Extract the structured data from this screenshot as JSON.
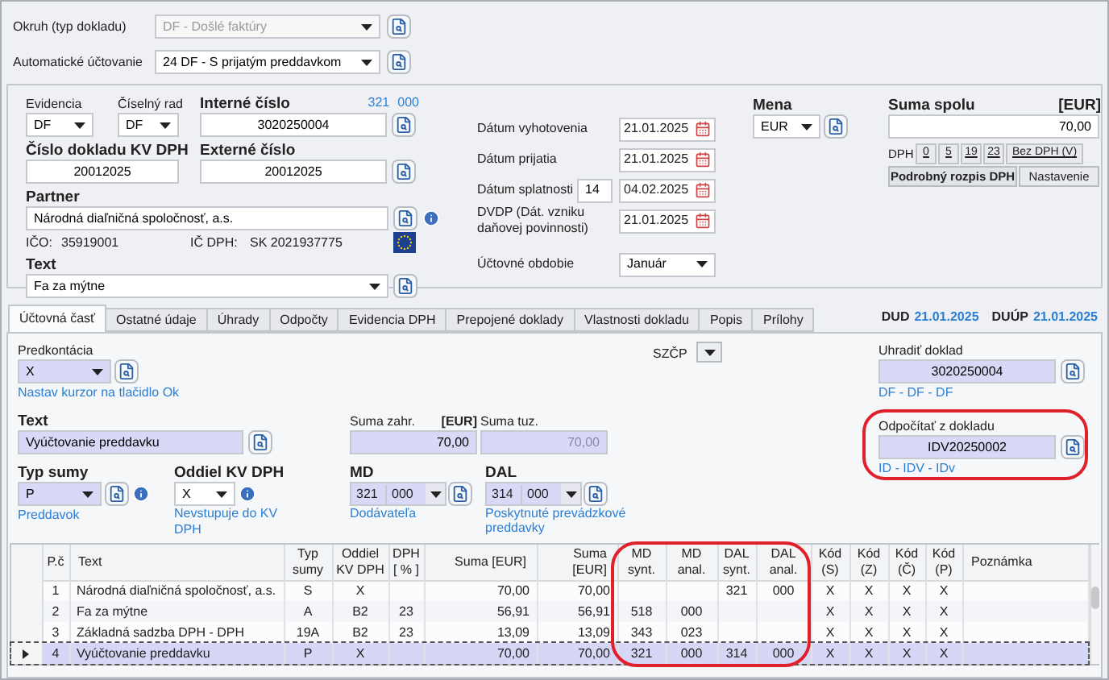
{
  "document_type": {
    "label": "Okruh (typ dokladu)",
    "value": "DF - Došlé faktúry",
    "disabled": true
  },
  "auto_posting": {
    "label": "Automatické účtovanie",
    "value": "24 DF - S prijatým preddavkom"
  },
  "evidence": {
    "label": "Evidencia",
    "value": "DF"
  },
  "number_series": {
    "label": "Číselný rad",
    "value": "DF"
  },
  "internal_number": {
    "label": "Interné číslo",
    "account_synt": "321",
    "account_anal": "000",
    "value": "3020250004"
  },
  "kv_dph_number": {
    "label": "Číslo dokladu KV DPH",
    "value": "20012025"
  },
  "external_number": {
    "label": "Externé číslo",
    "value": "20012025"
  },
  "partner": {
    "label": "Partner",
    "value": "Národná diaľničná spoločnosť, a.s.",
    "ico_label": "IČO:",
    "ico": "35919001",
    "ic_dph_label": "IČ DPH:",
    "ic_dph": "SK 2021937775"
  },
  "text": {
    "label": "Text",
    "value": "Fa za mýtne"
  },
  "dates": [
    {
      "label": "Dátum vyhotovenia",
      "value": "21.01.2025"
    },
    {
      "label": "Dátum prijatia",
      "value": "21.01.2025"
    },
    {
      "label": "Dátum splatnosti",
      "days": "14",
      "value": "04.02.2025"
    },
    {
      "label": "DVDP (Dát. vzniku daňovej povinnosti)",
      "value": "21.01.2025"
    }
  ],
  "accounting_period": {
    "label": "Účtovné obdobie",
    "value": "Január"
  },
  "currency": {
    "label": "Mena",
    "value": "EUR"
  },
  "total": {
    "label": "Suma spolu",
    "unit": "[EUR]",
    "value": "70,00",
    "vat_label": "DPH",
    "vat_buttons": [
      "0",
      "5",
      "19",
      "23",
      "Bez DPH (V)"
    ],
    "buttons": [
      "Podrobný rozpis DPH",
      "Nastavenie"
    ]
  },
  "tabs": [
    {
      "label": "Účtovná časť",
      "selected": true
    },
    {
      "label": "Ostatné údaje",
      "selected": false
    },
    {
      "label": "Úhrady",
      "selected": false
    },
    {
      "label": "Odpočty",
      "selected": false
    },
    {
      "label": "Evidencia DPH",
      "selected": false
    },
    {
      "label": "Prepojené doklady",
      "selected": false
    },
    {
      "label": "Vlastnosti dokladu",
      "selected": false
    },
    {
      "label": "Popis",
      "selected": false
    },
    {
      "label": "Prílohy",
      "selected": false
    }
  ],
  "due_dates": [
    {
      "label": "DUD",
      "value": "21.01.2025"
    },
    {
      "label": "DUÚP",
      "value": "21.01.2025"
    }
  ],
  "predkontacia": {
    "label": "Predkontácia",
    "value": "X",
    "hint": "Nastav kurzor na tlačidlo Ok"
  },
  "szcp": {
    "label": "SZČP"
  },
  "line_text": {
    "label": "Text",
    "value": "Vyúčtovanie preddavku"
  },
  "amount_foreign": {
    "label": "Suma zahr.",
    "unit": "[EUR]",
    "value": "70,00"
  },
  "amount_local": {
    "label": "Suma tuz.",
    "value": "70,00",
    "disabled": true
  },
  "amount_type": {
    "label": "Typ sumy",
    "value": "P",
    "hint": "Preddavok"
  },
  "kv_section": {
    "label": "Oddiel KV DPH",
    "value": "X",
    "hint": "Nevstupuje do KV DPH"
  },
  "md": {
    "label": "MD",
    "synt": "321",
    "anal": "000",
    "hint": "Dodávateľa"
  },
  "dal": {
    "label": "DAL",
    "synt": "314",
    "anal": "000",
    "hint": "Poskytnuté prevádzkové preddavky"
  },
  "pay_document": {
    "label": "Uhradiť doklad",
    "value": "3020250004",
    "link": "DF - DF - DF"
  },
  "deduct_document": {
    "label": "Odpočítať z dokladu",
    "value": "IDV20250002",
    "link": "ID - IDV - IDv",
    "highlighted": true
  },
  "table": {
    "highlight_account_columns": true,
    "columns": [
      "P.č",
      "Text",
      "Typ sumy",
      "Oddiel KV DPH",
      "DPH [ % ]",
      "Suma [EUR]",
      "Suma [EUR]",
      "MD synt.",
      "MD anal.",
      "DAL synt.",
      "DAL anal.",
      "Kód (S)",
      "Kód (Z)",
      "Kód (Č)",
      "Kód (P)",
      "Poznámka"
    ],
    "rows": [
      {
        "selected": false,
        "cells": [
          "1",
          "Národná diaľničná spoločnosť, a.s.",
          "S",
          "X",
          null,
          "70,00",
          "70,00",
          null,
          null,
          "321",
          "000",
          "X",
          "X",
          "X",
          "X",
          null
        ]
      },
      {
        "selected": false,
        "cells": [
          "2",
          "Fa za mýtne",
          "A",
          "B2",
          "23",
          "56,91",
          "56,91",
          "518",
          "000",
          null,
          null,
          "X",
          "X",
          "X",
          "X",
          null
        ]
      },
      {
        "selected": false,
        "cells": [
          "3",
          "Základná sadzba DPH - DPH",
          "19A",
          "B2",
          "23",
          "13,09",
          "13,09",
          "343",
          "023",
          null,
          null,
          "X",
          "X",
          "X",
          "X",
          null
        ]
      },
      {
        "selected": true,
        "cells": [
          "4",
          "Vyúčtovanie preddavku",
          "P",
          "X",
          null,
          "70,00",
          "70,00",
          "321",
          "000",
          "314",
          "000",
          "X",
          "X",
          "X",
          "X",
          null
        ]
      }
    ]
  }
}
